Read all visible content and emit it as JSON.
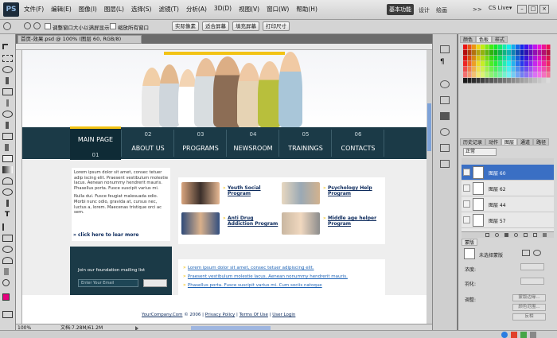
{
  "app": {
    "logo": "PS",
    "menu": [
      "文件(F)",
      "编辑(E)",
      "图像(I)",
      "图层(L)",
      "选择(S)",
      "滤镜(T)",
      "分析(A)",
      "3D(D)",
      "视图(V)",
      "窗口(W)",
      "帮助(H)"
    ],
    "workspace_active": "基本功能",
    "workspace_links": [
      "设计",
      "绘画"
    ],
    "more": ">>",
    "cs_live": "CS Live▾"
  },
  "options": {
    "checkbox1": "调整窗口大小以满屏显示",
    "checkbox2": "缩放所有窗口",
    "buttons": [
      "实际像素",
      "适合屏幕",
      "填充屏幕",
      "打印尺寸"
    ]
  },
  "document": {
    "tab": "首页-效果.psd @ 100% (图层 60, RGB/8)",
    "zoom": "100%",
    "doc_size": "文档:7.28M/61.2M"
  },
  "site": {
    "nav": [
      {
        "num": "01",
        "label": "MAIN PAGE"
      },
      {
        "num": "02",
        "label": "ABOUT US"
      },
      {
        "num": "03",
        "label": "PROGRAMS"
      },
      {
        "num": "04",
        "label": "NEWSROOM"
      },
      {
        "num": "05",
        "label": "TRAININGS"
      },
      {
        "num": "06",
        "label": "CONTACTS"
      }
    ],
    "intro_p1": "Lorem ipsum dolor sit amet, consec tetuer adip iscing elit. Praesent vestibulum molestie lacus. Aenean nonummy hendrerit mauris. Phasellus porta. Fusce suscipit varius mi.",
    "intro_p2": "Nulla dui. Fusce feugiat malesuada odio. Morbi nunc odio, gravida at, cursus nec, luctus a, lorem. Maecenas tristique orci ac sem.",
    "more_link": "» click here to lear more",
    "features": [
      "Youth Social Program",
      "Psychology Help Program",
      "Anti Drug Addiction Program",
      "Middle age helper Program"
    ],
    "mailing_title": "Join our foundation mailing list",
    "mailing_placeholder": "Enter Your Email",
    "links": [
      "Lorem ipsum dolor sit amet, consec tetuer adipiscing elit.",
      "Praesent vestibulum molestie lacus. Aenean nonummy hendrerit mauris.",
      "Phasellus porta. Fusce suscipit varius mi. Cum sociis natoque"
    ],
    "footer": {
      "company": "YourCompany.Com",
      "copy": "© 2006 |",
      "privacy": "Privacy Policy",
      "sep": "|",
      "terms": "Terms Of Use",
      "login": "User Login"
    }
  },
  "panels": {
    "swatch_tabs": [
      "颜色",
      "色板",
      "样式"
    ],
    "layer_tabs": [
      "历史记录",
      "动作",
      "图层",
      "通道",
      "路径"
    ],
    "blend_mode": "正常",
    "layers": [
      "图层 60",
      "图层 62",
      "图层 44",
      "图层 57"
    ],
    "mask_tab": "蒙版",
    "mask_title": "未选择蒙版",
    "mask_labels": [
      "浓度:",
      "羽化:",
      "调整:"
    ],
    "mask_buttons": [
      "蒙版边缘...",
      "颜色范围...",
      "反相"
    ]
  },
  "colors": {
    "nav_bg": "#1b3a47",
    "nav_active": "#0f2b36",
    "accent": "#f2c315",
    "link": "#0c2a5c",
    "selected_layer": "#3a6fc4"
  }
}
